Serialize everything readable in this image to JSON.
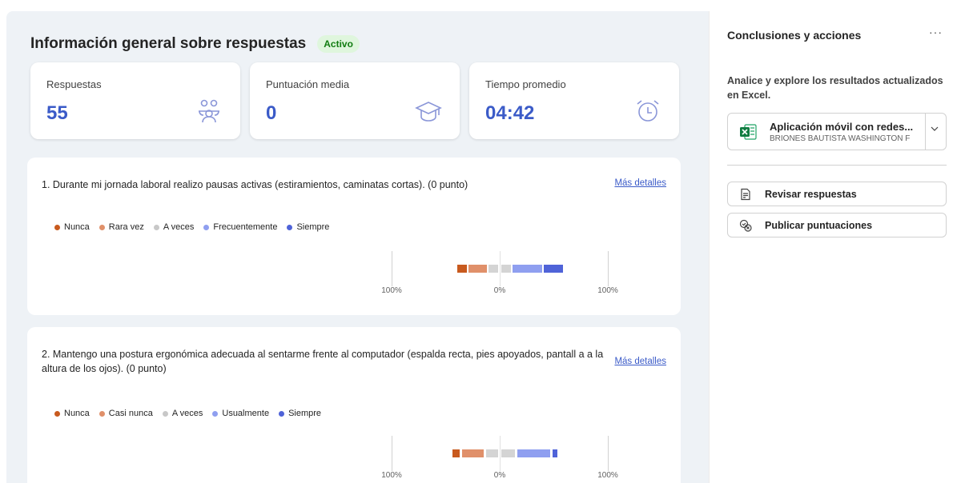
{
  "header": {
    "title": "Información general sobre respuestas",
    "status": "Activo"
  },
  "stats": [
    {
      "label": "Respuestas",
      "value": "55",
      "icon": "people-icon"
    },
    {
      "label": "Puntuación media",
      "value": "0",
      "icon": "graduation-cap-icon"
    },
    {
      "label": "Tiempo promedio",
      "value": "04:42",
      "icon": "alarm-clock-icon"
    }
  ],
  "questions": [
    {
      "text": "1. Durante mi jornada laboral realizo pausas activas (estiramientos, caminatas cortas). (0 punto)",
      "more": "Más detalles",
      "legend": [
        "Nunca",
        "Rara vez",
        "A veces",
        "Frecuentemente",
        "Siempre"
      ],
      "axis": [
        "100%",
        "0%",
        "100%"
      ]
    },
    {
      "text": "2. Mantengo una postura ergonómica adecuada al sentarme frente al computador (espalda recta, pies apoyados, pantall a a la altura de los ojos). (0 punto)",
      "more": "Más detalles",
      "legend": [
        "Nunca",
        "Casi nunca",
        "A veces",
        "Usualmente",
        "Siempre"
      ],
      "axis": [
        "100%",
        "0%",
        "100%"
      ]
    }
  ],
  "legend_colors": [
    "#c85a1e",
    "#e0906a",
    "#c8c8c8",
    "#8f9ff0",
    "#4f63d8"
  ],
  "sidebar": {
    "title": "Conclusiones y acciones",
    "more": "···",
    "description": "Analice y explore los resultados actualizados en Excel.",
    "excel": {
      "name": "Aplicación móvil con redes...",
      "owner": "BRIONES BAUTISTA WASHINGTON F"
    },
    "actions": [
      {
        "label": "Revisar respuestas",
        "icon": "review-document-icon"
      },
      {
        "label": "Publicar puntuaciones",
        "icon": "publish-scores-icon"
      }
    ]
  }
}
